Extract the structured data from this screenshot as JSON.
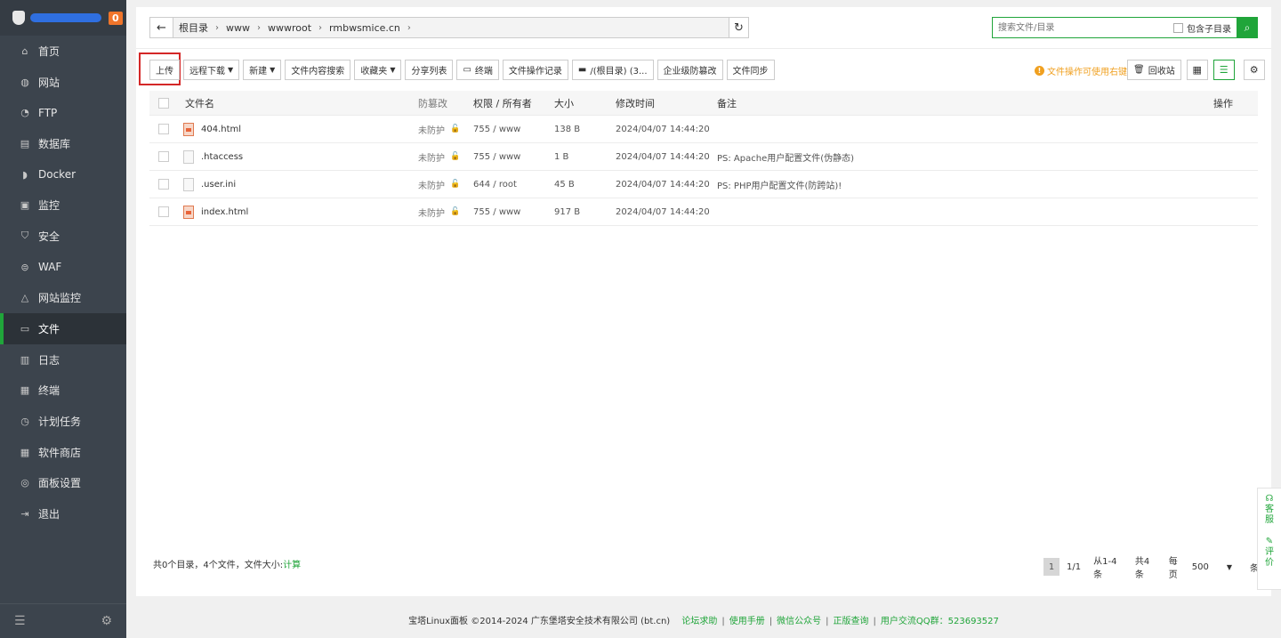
{
  "sidebar": {
    "badge": "0",
    "items": [
      {
        "label": "首页",
        "icon": "home-icon",
        "glyph": "⌂"
      },
      {
        "label": "网站",
        "icon": "globe-icon",
        "glyph": "◍"
      },
      {
        "label": "FTP",
        "icon": "ftp-icon",
        "glyph": "◔"
      },
      {
        "label": "数据库",
        "icon": "database-icon",
        "glyph": "▤"
      },
      {
        "label": "Docker",
        "icon": "docker-icon",
        "glyph": "◗"
      },
      {
        "label": "监控",
        "icon": "monitor-icon",
        "glyph": "▣"
      },
      {
        "label": "安全",
        "icon": "shield-icon",
        "glyph": "⛉"
      },
      {
        "label": "WAF",
        "icon": "waf-icon",
        "glyph": "⊜"
      },
      {
        "label": "网站监控",
        "icon": "site-monitor-icon",
        "glyph": "△"
      },
      {
        "label": "文件",
        "icon": "folder-icon",
        "glyph": "▭"
      },
      {
        "label": "日志",
        "icon": "log-icon",
        "glyph": "▥"
      },
      {
        "label": "终端",
        "icon": "terminal-icon",
        "glyph": "▦"
      },
      {
        "label": "计划任务",
        "icon": "schedule-icon",
        "glyph": "◷"
      },
      {
        "label": "软件商店",
        "icon": "store-icon",
        "glyph": "▦"
      },
      {
        "label": "面板设置",
        "icon": "settings-icon",
        "glyph": "◎"
      },
      {
        "label": "退出",
        "icon": "logout-icon",
        "glyph": "⇥"
      }
    ]
  },
  "path": {
    "crumbs": [
      "根目录",
      "www",
      "wwwroot",
      "rmbwsmice.cn"
    ]
  },
  "search": {
    "placeholder": "搜索文件/目录",
    "sub_label": "包含子目录"
  },
  "toolbar": {
    "upload": "上传",
    "remote_download": "远程下载",
    "new": "新建",
    "content_search": "文件内容搜索",
    "favorites": "收藏夹",
    "share_list": "分享列表",
    "terminal": "终端",
    "op_log": "文件操作记录",
    "disk": "/(根目录) (3...",
    "tamper": "企业级防篡改",
    "sync": "文件同步",
    "tips": "文件操作可使用右键",
    "recycle": "回收站"
  },
  "table": {
    "headers": {
      "name": "文件名",
      "protect": "防篡改",
      "perm": "权限 / 所有者",
      "size": "大小",
      "mtime": "修改时间",
      "note": "备注",
      "op": "操作"
    },
    "rows": [
      {
        "name": "404.html",
        "type": "html",
        "protect": "未防护",
        "perm": "755 / www",
        "size": "138 B",
        "mtime": "2024/04/07 14:44:20",
        "note": ""
      },
      {
        "name": ".htaccess",
        "type": "file",
        "protect": "未防护",
        "perm": "755 / www",
        "size": "1 B",
        "mtime": "2024/04/07 14:44:20",
        "note": "PS: Apache用户配置文件(伪静态)"
      },
      {
        "name": ".user.ini",
        "type": "file",
        "protect": "未防护",
        "perm": "644 / root",
        "size": "45 B",
        "mtime": "2024/04/07 14:44:20",
        "note": "PS: PHP用户配置文件(防跨站)!"
      },
      {
        "name": "index.html",
        "type": "html",
        "protect": "未防护",
        "perm": "755 / www",
        "size": "917 B",
        "mtime": "2024/04/07 14:44:20",
        "note": ""
      }
    ]
  },
  "summary": {
    "text": "共0个目录，4个文件，文件大小:",
    "calc": "计算"
  },
  "pager": {
    "current": "1",
    "pages": "1/1",
    "range": "从1-4条",
    "total": "共4条",
    "per_label": "每页",
    "per_value": "500",
    "unit": "条"
  },
  "footer": {
    "copyright": "宝塔Linux面板 ©2014-2024 广东堡塔安全技术有限公司 (bt.cn)",
    "links": [
      "论坛求助",
      "使用手册",
      "微信公众号",
      "正版查询",
      "用户交流QQ群：523693527"
    ]
  },
  "float": {
    "service": "客服",
    "review": "评价"
  },
  "colors": {
    "accent": "#20a53a",
    "highlight": "#d42727",
    "sidebar_bg": "#3c444d"
  }
}
